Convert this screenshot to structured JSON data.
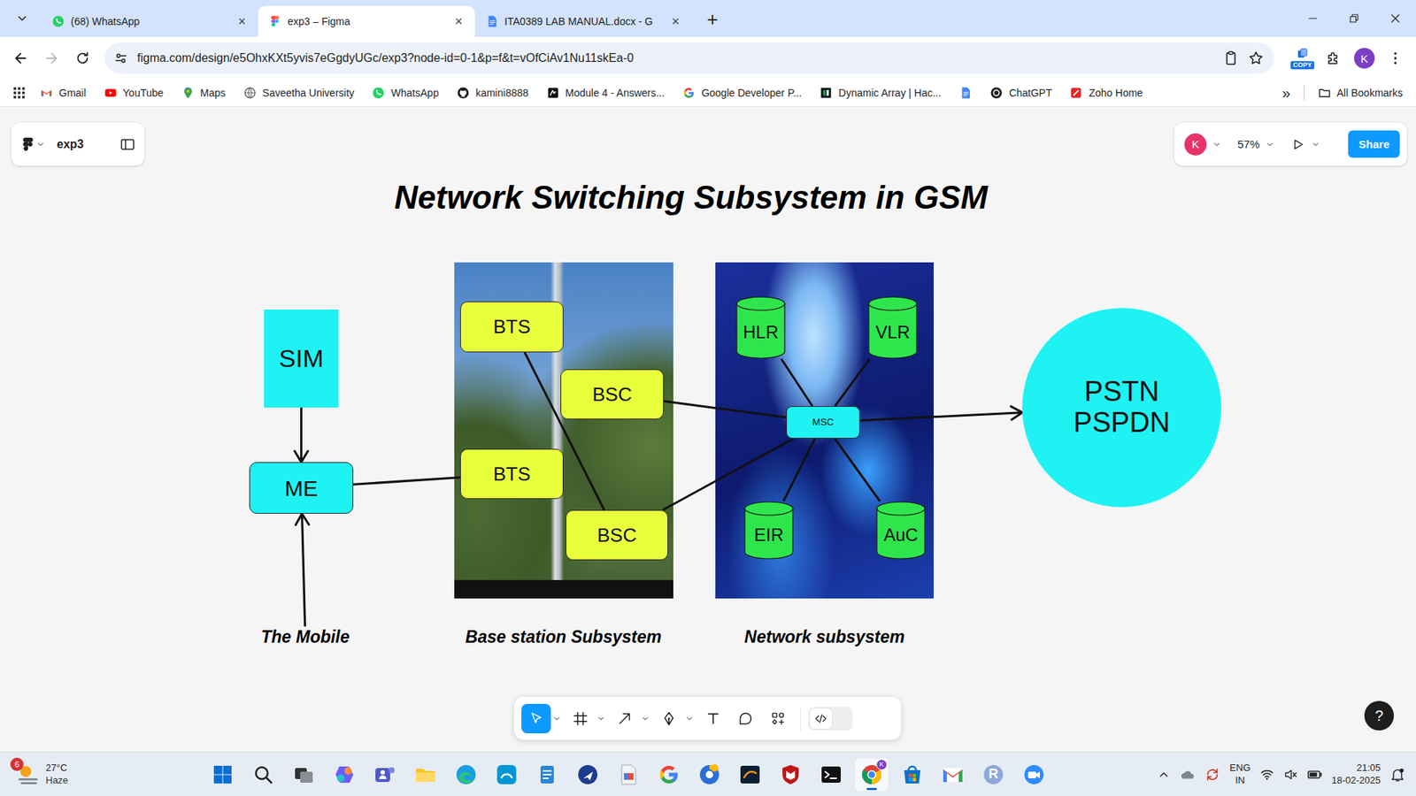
{
  "browser": {
    "tabs": [
      {
        "kind": "whatsapp",
        "label": "(68) WhatsApp",
        "close": "×",
        "selected": false
      },
      {
        "kind": "figma",
        "label": "exp3 – Figma",
        "close": "×",
        "selected": true
      },
      {
        "kind": "docs",
        "label": "ITA0389 LAB MANUAL.docx - G",
        "close": "×",
        "selected": false
      }
    ],
    "new_tab": "+",
    "nav": [
      {
        "kind": "back",
        "disabled": false
      },
      {
        "kind": "forward",
        "disabled": true
      },
      {
        "kind": "reload",
        "disabled": false
      }
    ],
    "address": "figma.com/design/e5OhxKXt5yvis7eGgdyUGc/exp3?node-id=0-1&p=f&t=vOfCiAv1Nu11skEa-0",
    "extension": "COPY",
    "profile": "K",
    "bookmarks": [
      {
        "kind": "gmail",
        "label": "Gmail"
      },
      {
        "kind": "youtube",
        "label": "YouTube"
      },
      {
        "kind": "maps",
        "label": "Maps"
      },
      {
        "kind": "globe",
        "label": "Saveetha University"
      },
      {
        "kind": "whatsapp",
        "label": "WhatsApp"
      },
      {
        "kind": "github",
        "label": "kamini8888"
      },
      {
        "kind": "module",
        "label": "Module 4 - Answers..."
      },
      {
        "kind": "google",
        "label": "Google Developer P..."
      },
      {
        "kind": "hackerrank",
        "label": "Dynamic Array | Hac..."
      },
      {
        "kind": "docs"
      },
      {
        "kind": "chatgpt",
        "label": "ChatGPT"
      },
      {
        "kind": "zoho",
        "label": "Zoho Home"
      }
    ],
    "more": "»",
    "all_bookmarks": "All Bookmarks"
  },
  "figma": {
    "file": "exp3",
    "avatar": "K",
    "zoom": "57%",
    "share": "Share",
    "help": "?",
    "tools": [
      {
        "kind": "move",
        "selected": true,
        "dropdown": true
      },
      {
        "kind": "frame",
        "selected": false,
        "dropdown": true
      },
      {
        "kind": "shape",
        "selected": false,
        "dropdown": true
      },
      {
        "kind": "pen",
        "selected": false,
        "dropdown": true
      },
      {
        "kind": "text",
        "selected": false,
        "dropdown": false
      },
      {
        "kind": "comment",
        "selected": false,
        "dropdown": false
      },
      {
        "kind": "actions",
        "selected": false,
        "dropdown": false
      }
    ],
    "dev_mode": {
      "on": false
    }
  },
  "diagram": {
    "title": "Network Switching Subsystem in GSM",
    "panels": [
      {
        "kind": "tower-photo"
      },
      {
        "kind": "network-photo"
      }
    ],
    "nodes": [
      {
        "label": "SIM",
        "kind": "rect",
        "color": "#1ff2f2"
      },
      {
        "label": "ME",
        "kind": "rounded",
        "color": "#1ff2f2"
      },
      {
        "label": "BTS",
        "kind": "rounded",
        "color": "#e8ff3c"
      },
      {
        "label": "BSC",
        "kind": "rounded",
        "color": "#e8ff3c"
      },
      {
        "label": "BTS",
        "kind": "rounded",
        "color": "#e8ff3c"
      },
      {
        "label": "BSC",
        "kind": "rounded",
        "color": "#e8ff3c"
      },
      {
        "label": "HLR",
        "kind": "cylinder",
        "color": "#2ee64c"
      },
      {
        "label": "VLR",
        "kind": "cylinder",
        "color": "#2ee64c"
      },
      {
        "label": "EIR",
        "kind": "cylinder",
        "color": "#2ee64c"
      },
      {
        "label": "AuC",
        "kind": "cylinder",
        "color": "#2ee64c"
      },
      {
        "label": "MSC",
        "kind": "rounded",
        "color": "#1ff2f2"
      },
      {
        "label": "PSTN\nPSPDN",
        "kind": "circle",
        "color": "#1ff2f2"
      },
      {
        "label": "The Mobile",
        "kind": "caption"
      },
      {
        "label": "Base station Subsystem",
        "kind": "caption"
      },
      {
        "label": "Network subsystem",
        "kind": "caption"
      }
    ],
    "edges": [
      {
        "from": 0,
        "to": 1,
        "arrow": true
      },
      {
        "from": 12,
        "to": 1,
        "arrow": true
      },
      {
        "from": 1,
        "to": 4,
        "arrow": false
      },
      {
        "from": 2,
        "to": 5,
        "arrow": false
      },
      {
        "from": 3,
        "to": 10,
        "arrow": false
      },
      {
        "from": 5,
        "to": 10,
        "arrow": false
      },
      {
        "from": 6,
        "to": 10,
        "arrow": false
      },
      {
        "from": 7,
        "to": 10,
        "arrow": false
      },
      {
        "from": 8,
        "to": 10,
        "arrow": false
      },
      {
        "from": 9,
        "to": 10,
        "arrow": false
      },
      {
        "from": 10,
        "to": 11,
        "arrow": true
      }
    ]
  },
  "taskbar": {
    "weather": {
      "temp": "27°C",
      "condition": "Haze",
      "badge": "6"
    },
    "apps": [
      {
        "kind": "windows",
        "selected": false
      },
      {
        "kind": "search",
        "selected": false
      },
      {
        "kind": "taskview",
        "selected": false
      },
      {
        "kind": "copilot",
        "selected": false
      },
      {
        "kind": "teams",
        "selected": false
      },
      {
        "kind": "explorer",
        "selected": false
      },
      {
        "kind": "edge",
        "selected": false
      },
      {
        "kind": "myhp",
        "selected": false
      },
      {
        "kind": "notepad",
        "selected": false
      },
      {
        "kind": "blueapp",
        "selected": false
      },
      {
        "kind": "pdf",
        "selected": false
      },
      {
        "kind": "google",
        "selected": false
      },
      {
        "kind": "chromebeta",
        "selected": false
      },
      {
        "kind": "mysql",
        "selected": false
      },
      {
        "kind": "mcafee",
        "selected": false
      },
      {
        "kind": "terminal",
        "selected": false
      },
      {
        "kind": "chrome",
        "selected": true,
        "badge": "K"
      },
      {
        "kind": "store",
        "selected": false
      },
      {
        "kind": "gmail",
        "selected": false
      },
      {
        "kind": "r",
        "selected": false,
        "glyph": "R"
      },
      {
        "kind": "zoom",
        "selected": false
      }
    ],
    "tray": {
      "lang": "ENG",
      "region": "IN",
      "time": "21:05",
      "date": "18-02-2025"
    }
  }
}
